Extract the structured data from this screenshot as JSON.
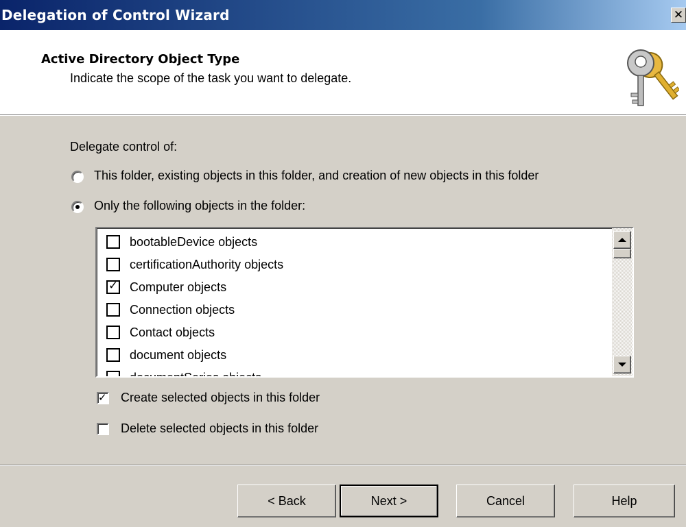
{
  "window": {
    "title": "Delegation of Control Wizard",
    "close_glyph": "✕"
  },
  "header": {
    "title": "Active Directory Object Type",
    "subtitle": "Indicate the scope of the task you want to delegate.",
    "icon": "keys-icon"
  },
  "delegate": {
    "label": "Delegate control of:",
    "options": [
      {
        "label": "This folder, existing objects in this folder, and creation of new objects in this folder",
        "selected": false
      },
      {
        "label": "Only the following objects in the folder:",
        "selected": true
      }
    ]
  },
  "objects_list": {
    "items": [
      {
        "label": "bootableDevice objects",
        "checked": false
      },
      {
        "label": "certificationAuthority objects",
        "checked": false
      },
      {
        "label": "Computer objects",
        "checked": true
      },
      {
        "label": "Connection objects",
        "checked": false
      },
      {
        "label": "Contact objects",
        "checked": false
      },
      {
        "label": "document objects",
        "checked": false
      },
      {
        "label": "documentSeries objects",
        "checked": false
      }
    ]
  },
  "options": [
    {
      "label": "Create selected objects in this folder",
      "checked": true
    },
    {
      "label": "Delete selected objects in this folder",
      "checked": false
    }
  ],
  "buttons": {
    "back": "< Back",
    "next": "Next >",
    "cancel": "Cancel",
    "help": "Help"
  },
  "colors": {
    "titlebar_start": "#0a246a",
    "titlebar_end": "#a6caf0",
    "face": "#d4d0c8"
  }
}
